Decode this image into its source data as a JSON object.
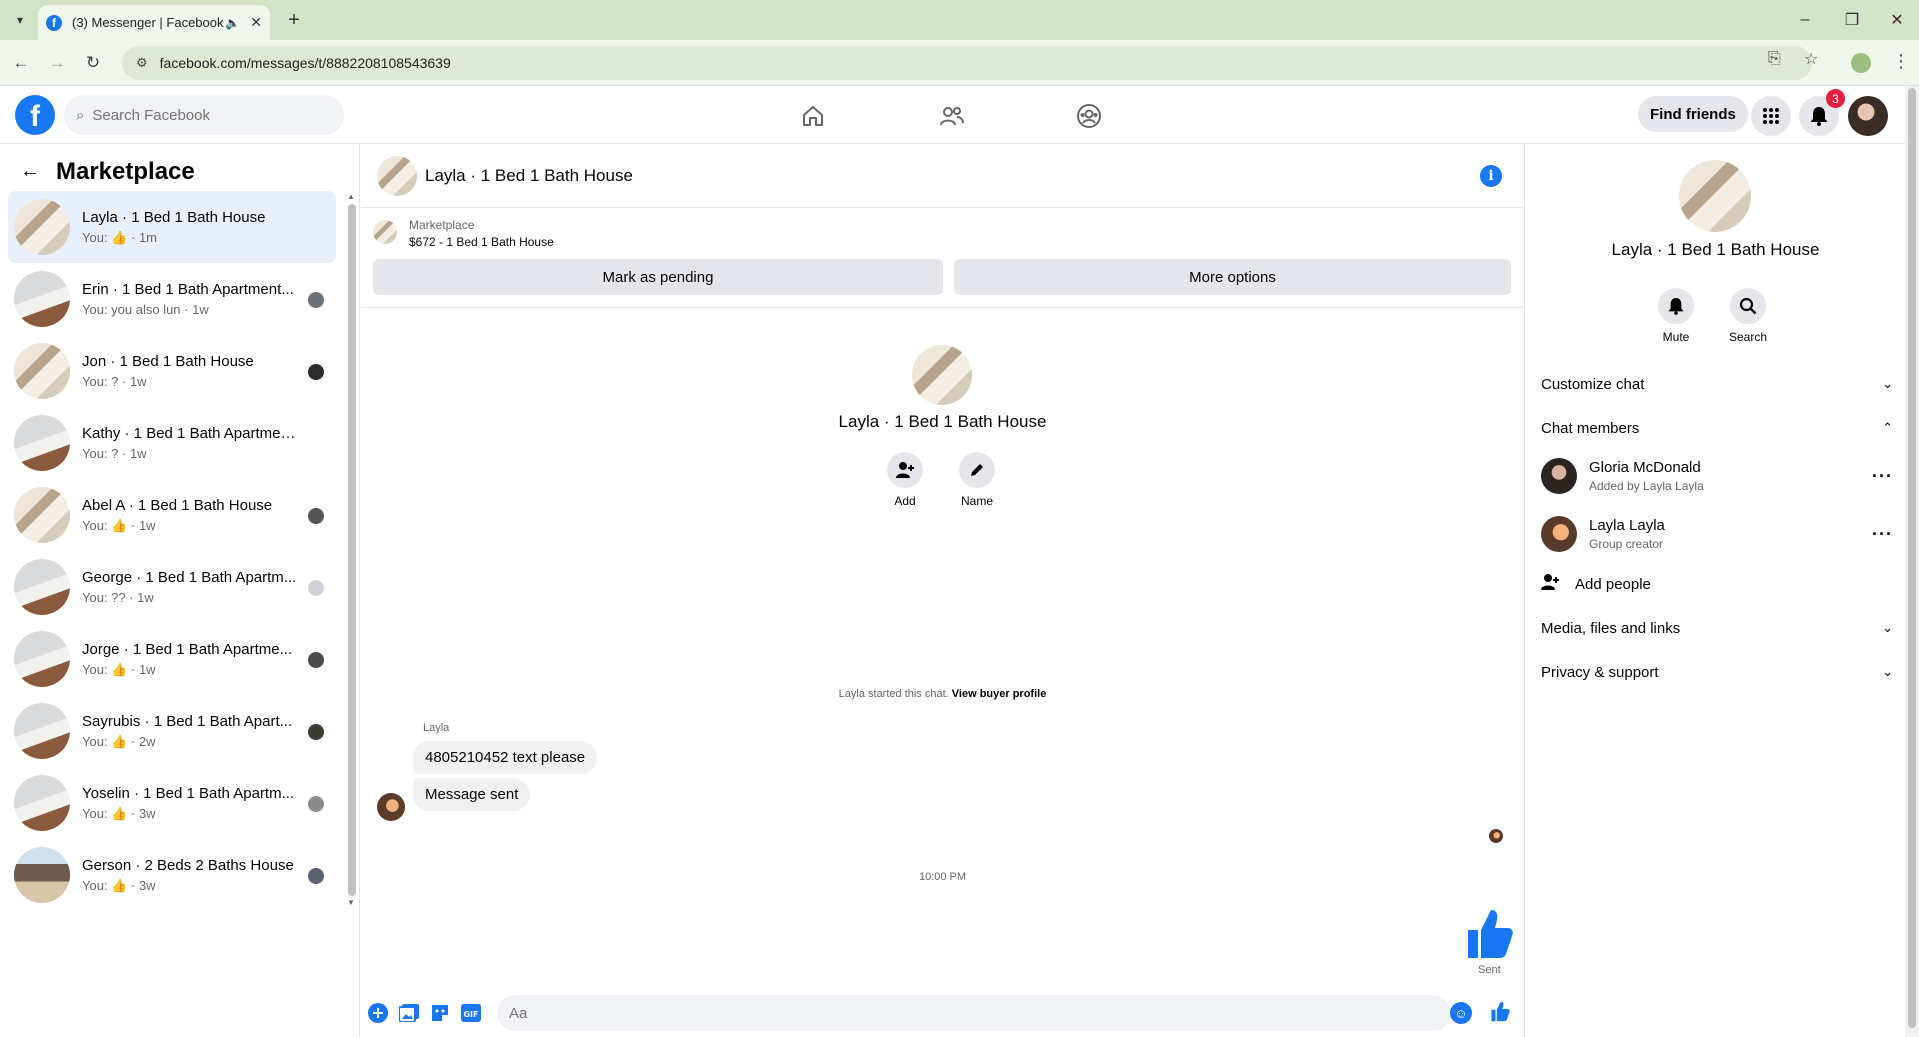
{
  "browser": {
    "tab_title": "(3) Messenger | Facebook",
    "url": "facebook.com/messages/t/8882208108543639"
  },
  "fb_header": {
    "search_placeholder": "Search Facebook",
    "find_friends_label": "Find friends",
    "notification_count": "3",
    "brand_color": "#1877f2"
  },
  "sidebar": {
    "title": "Marketplace",
    "conversations": [
      {
        "name": "Layla · 1 Bed 1 Bath House",
        "preview": "You:",
        "preview_icon": "thumbs-up-icon",
        "time": "· 1m"
      },
      {
        "name": "Erin · 1 Bed 1 Bath Apartment...",
        "preview": "You: you also lun · 1w",
        "preview_icon": "",
        "time": ""
      },
      {
        "name": "Jon · 1 Bed 1 Bath House",
        "preview": "You: ? · 1w",
        "preview_icon": "",
        "time": ""
      },
      {
        "name": "Kathy · 1 Bed 1 Bath Apartment/...",
        "preview": "You: ? · 1w",
        "preview_icon": "",
        "time": ""
      },
      {
        "name": "Abel A · 1 Bed 1 Bath House",
        "preview": "You:",
        "preview_icon": "thumbs-up-icon",
        "time": "· 1w"
      },
      {
        "name": "George · 1 Bed 1 Bath Apartm...",
        "preview": "You: ?? · 1w",
        "preview_icon": "",
        "time": ""
      },
      {
        "name": "Jorge · 1 Bed 1 Bath Apartme...",
        "preview": "You:",
        "preview_icon": "thumbs-up-icon",
        "time": "· 1w"
      },
      {
        "name": "Sayrubis · 1 Bed 1 Bath Apart...",
        "preview": "You:",
        "preview_icon": "thumbs-up-icon",
        "time": "· 2w"
      },
      {
        "name": "Yoselin · 1 Bed 1 Bath Apartm...",
        "preview": "You:",
        "preview_icon": "thumbs-up-icon",
        "time": "· 3w"
      },
      {
        "name": "Gerson · 2 Beds 2 Baths House",
        "preview": "You:",
        "preview_icon": "thumbs-up-icon",
        "time": "· 3w"
      }
    ]
  },
  "chat": {
    "title": "Layla · 1 Bed 1 Bath House",
    "marketplace_label": "Marketplace",
    "listing": "$672 - 1 Bed 1 Bath House",
    "mark_pending_label": "Mark as pending",
    "more_options_label": "More options",
    "intro_name": "Layla · 1 Bed 1 Bath House",
    "add_label": "Add",
    "name_label": "Name",
    "started_text": "Layla started this chat.",
    "view_buyer_label": "View buyer profile",
    "sender_name": "Layla",
    "messages": [
      "4805210452 text please",
      "Message sent"
    ],
    "timestamp": "10:00 PM",
    "sent_label": "Sent",
    "composer_placeholder": "Aa"
  },
  "details": {
    "name": "Layla · 1 Bed 1 Bath House",
    "mute_label": "Mute",
    "search_label": "Search",
    "customize_label": "Customize chat",
    "members_label": "Chat members",
    "members": [
      {
        "name": "Gloria McDonald",
        "sub": "Added by Layla Layla"
      },
      {
        "name": "Layla Layla",
        "sub": "Group creator"
      }
    ],
    "add_people_label": "Add people",
    "media_label": "Media, files and links",
    "privacy_label": "Privacy & support"
  }
}
